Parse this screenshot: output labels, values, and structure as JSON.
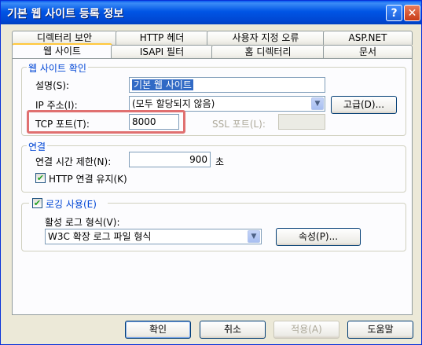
{
  "title": "기본 웹 사이트 등록 정보",
  "title_buttons": {
    "help": "?",
    "close": "✕"
  },
  "tabs_row1": [
    "디렉터리 보안",
    "HTTP 헤더",
    "사용자 지정 오류",
    "ASP.NET"
  ],
  "tabs_row2": [
    "웹 사이트",
    "ISAPI 필터",
    "홈 디렉터리",
    "문서"
  ],
  "site_group": {
    "legend": "웹 사이트 확인",
    "desc_label": "설명(S):",
    "desc_value": "기본 웹 사이트",
    "ip_label": "IP 주소(I):",
    "ip_value": "(모두 할당되지 않음)",
    "advanced_button": "고급(D)...",
    "tcp_label": "TCP 포트(T):",
    "tcp_value": "8000",
    "ssl_label": "SSL 포트(L):",
    "ssl_value": ""
  },
  "connection_group": {
    "legend": "연결",
    "timeout_label": "연결 시간 제한(N):",
    "timeout_value": "900",
    "timeout_unit": "초",
    "keepalive_label": "HTTP 연결 유지(K)",
    "keepalive_checked": true
  },
  "logging_group": {
    "enable_label": "로깅 사용(E)",
    "enable_checked": true,
    "format_label": "활성 로그 형식(V):",
    "format_value": "W3C 확장 로그 파일 형식",
    "properties_button": "속성(P)..."
  },
  "buttons": {
    "ok": "확인",
    "cancel": "취소",
    "apply": "적용(A)",
    "help": "도움말"
  }
}
